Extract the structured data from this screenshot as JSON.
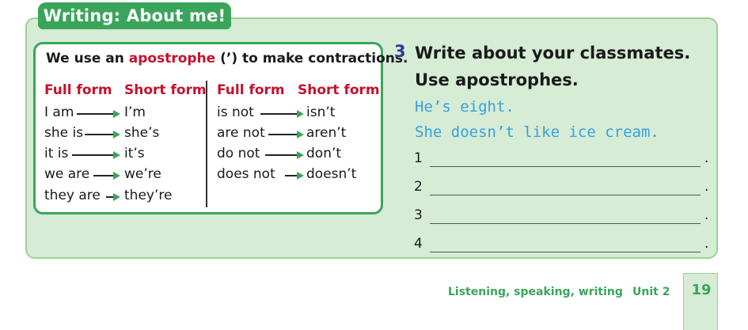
{
  "title": "Writing: About me!",
  "rule": {
    "prefix": "We use an ",
    "highlight": "apostrophe",
    "suffix": " (’) to make contractions."
  },
  "headers": {
    "full_form": "Full form",
    "short_form": "Short form"
  },
  "left_pairs": [
    {
      "full": "I am",
      "short": "I’m"
    },
    {
      "full": "she is",
      "short": "she’s"
    },
    {
      "full": "it is",
      "short": "it’s"
    },
    {
      "full": "we are",
      "short": "we’re"
    },
    {
      "full": "they are",
      "short": "they’re"
    }
  ],
  "right_pairs": [
    {
      "full": "is not",
      "short": "isn’t"
    },
    {
      "full": "are not",
      "short": "aren’t"
    },
    {
      "full": "do not",
      "short": "don’t"
    },
    {
      "full": "does not",
      "short": "doesn’t"
    }
  ],
  "exercise": {
    "number": "3",
    "instruction": "Write about your classmates. Use apostrophes.",
    "examples": [
      "He’s eight.",
      "She doesn’t like ice cream."
    ],
    "lines": [
      "1",
      "2",
      "3",
      "4"
    ],
    "line_end": "."
  },
  "footer": {
    "section": "Listening, speaking, writing",
    "unit": "Unit 2",
    "page": "19"
  },
  "colors": {
    "green": "#3aa55a",
    "red": "#c8102e",
    "blue_handwriting": "#3aa0dc",
    "number_blue": "#2b3a99"
  }
}
